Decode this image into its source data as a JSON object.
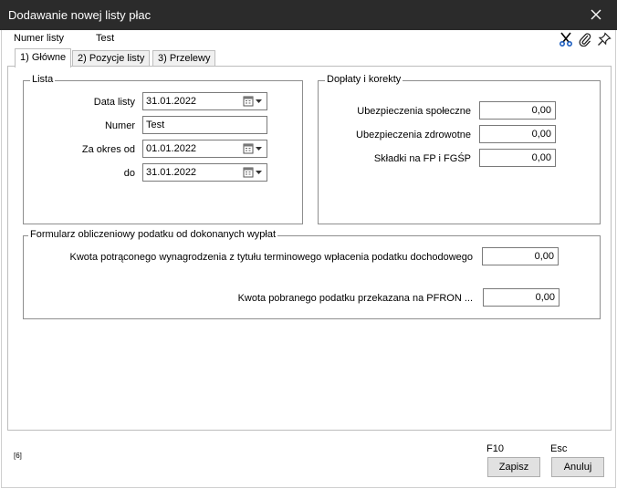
{
  "window": {
    "title": "Dodawanie nowej listy płac"
  },
  "header": {
    "list_number_label": "Numer listy",
    "list_number_value": "Test"
  },
  "tabs": [
    {
      "label": "1) Główne"
    },
    {
      "label": "2) Pozycje listy"
    },
    {
      "label": "3) Przelewy"
    }
  ],
  "lista": {
    "legend": "Lista",
    "date_label": "Data listy",
    "date_value": "31.01.2022",
    "number_label": "Numer",
    "number_value": "Test",
    "period_from_label": "Za okres od",
    "period_from_value": "01.01.2022",
    "period_to_label": "do",
    "period_to_value": "31.01.2022"
  },
  "doplaty": {
    "legend": "Dopłaty i korekty",
    "social_label": "Ubezpieczenia społeczne",
    "social_value": "0,00",
    "health_label": "Ubezpieczenia zdrowotne",
    "health_value": "0,00",
    "fp_label": "Składki na FP i FGŚP",
    "fp_value": "0,00"
  },
  "formularz": {
    "legend": "Formularz obliczeniowy podatku od dokonanych wypłat",
    "withheld_label": "Kwota potrąconego wynagrodzenia z tytułu terminowego wpłacenia podatku dochodowego",
    "withheld_value": "0,00",
    "pfron_label": "Kwota pobranego podatku przekazana na PFRON ...",
    "pfron_value": "0,00"
  },
  "footer": {
    "counter": "[6]",
    "save_key": "F10",
    "cancel_key": "Esc",
    "save_label": "Zapisz",
    "cancel_label": "Anuluj"
  },
  "colors": {
    "titlebar": "#2b2b2b",
    "button_face": "#e1e1e1",
    "accent_icon": "#1f5fbf"
  }
}
